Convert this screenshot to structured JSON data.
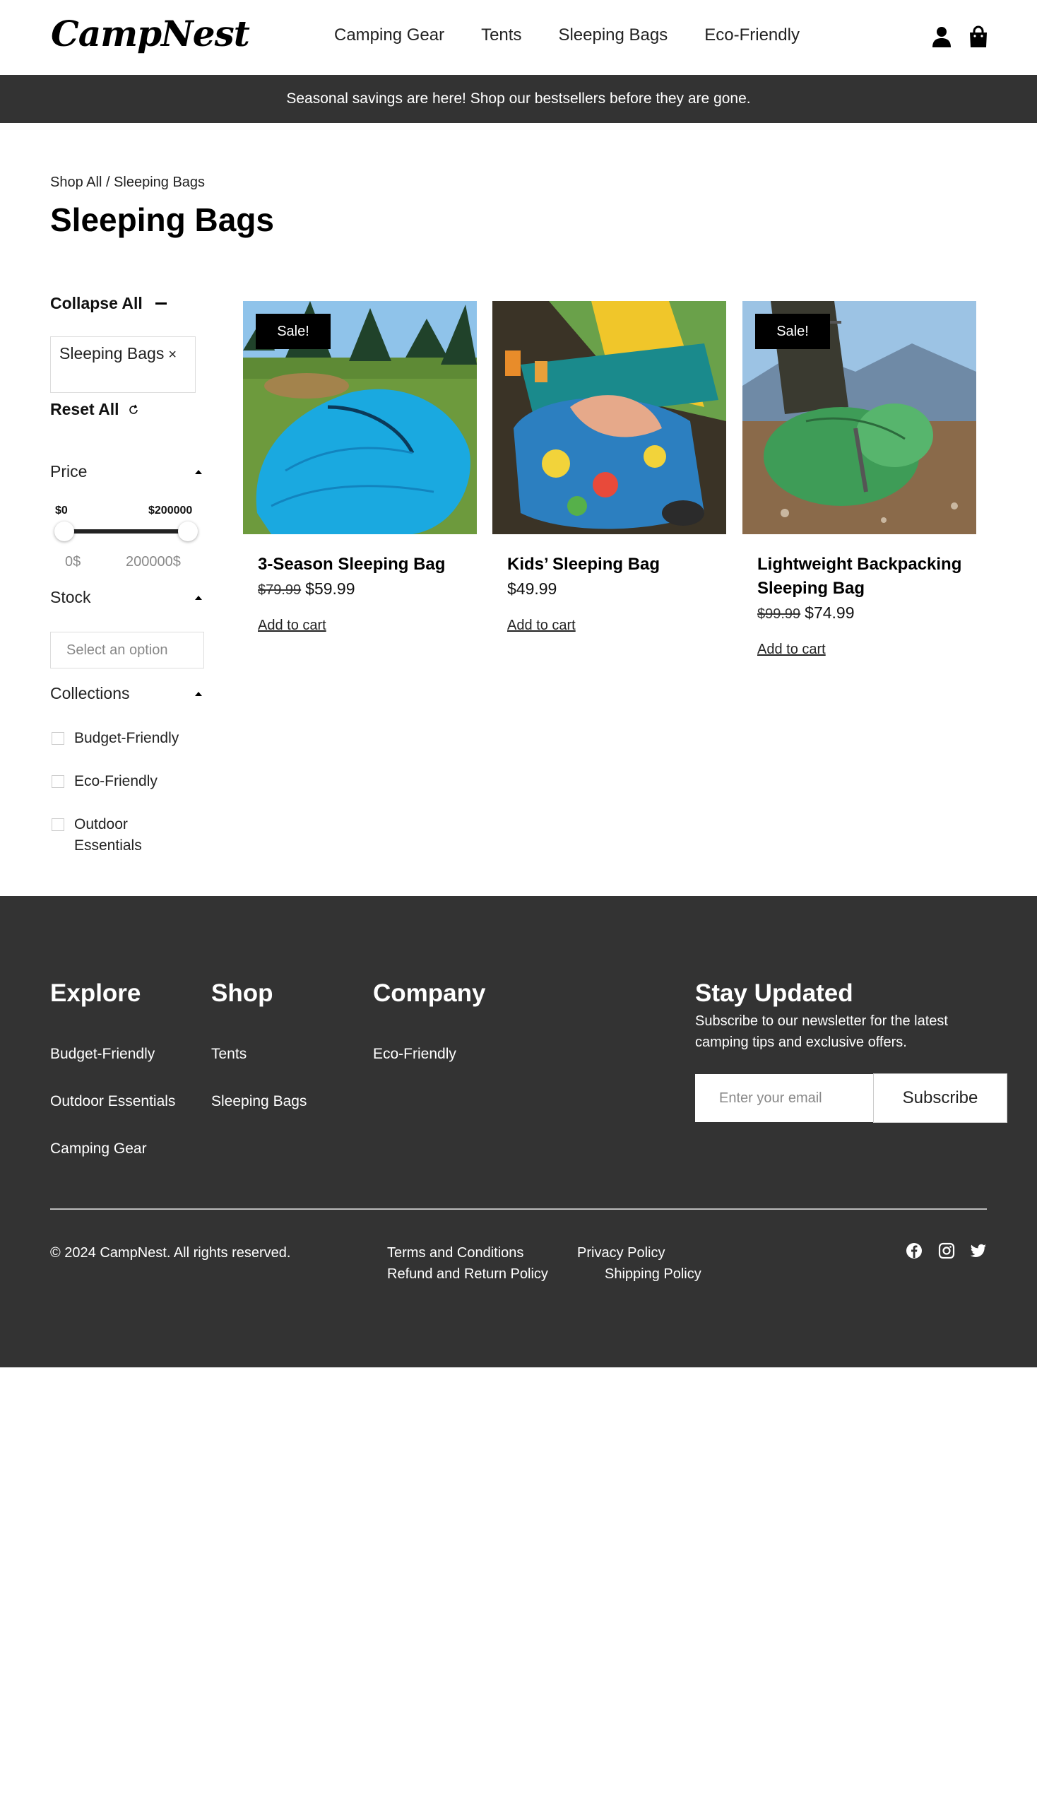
{
  "header": {
    "logo": "CampNest",
    "nav": [
      "Camping Gear",
      "Tents",
      "Sleeping Bags",
      "Eco-Friendly"
    ],
    "icons": [
      "user-icon",
      "shopping-bag-icon"
    ]
  },
  "announcement": "Seasonal savings are here! Shop our bestsellers before they are gone.",
  "breadcrumb": "Shop All / Sleeping Bags",
  "page_title": "Sleeping Bags",
  "sidebar": {
    "collapse_all": "Collapse All",
    "active_filter": "Sleeping Bags",
    "active_filter_remove": "×",
    "reset_all": "Reset All",
    "price": {
      "label": "Price",
      "min_label": "$0",
      "max_label": "$200000",
      "min_output": "0$",
      "max_output": "200000$"
    },
    "stock": {
      "label": "Stock",
      "placeholder": "Select an option"
    },
    "collections": {
      "label": "Collections",
      "items": [
        "Budget-Friendly",
        "Eco-Friendly",
        "Outdoor Essentials"
      ]
    }
  },
  "products": [
    {
      "name": "3-Season Sleeping Bag",
      "badge": "Sale!",
      "old_price": "$79.99",
      "price": "$59.99",
      "cta": "Add to cart"
    },
    {
      "name": "Kids’ Sleeping Bag",
      "badge": "",
      "old_price": "",
      "price": "$49.99",
      "cta": "Add to cart"
    },
    {
      "name": "Lightweight Backpacking Sleeping Bag",
      "badge": "Sale!",
      "old_price": "$99.99",
      "price": "$74.99",
      "cta": "Add to cart"
    }
  ],
  "footer": {
    "explore": {
      "heading": "Explore",
      "links": [
        "Budget-Friendly",
        "Outdoor Essentials",
        "Camping Gear"
      ]
    },
    "shop": {
      "heading": "Shop",
      "links": [
        "Tents",
        "Sleeping Bags"
      ]
    },
    "company": {
      "heading": "Company",
      "links": [
        "Eco-Friendly"
      ]
    },
    "newsletter": {
      "heading": "Stay Updated",
      "description": "Subscribe to our newsletter for the latest camping tips and exclusive offers.",
      "placeholder": "Enter your email",
      "button": "Subscribe"
    },
    "copyright": "© 2024 CampNest. All rights reserved.",
    "policies": [
      "Terms and Conditions",
      "Privacy Policy",
      "Refund and Return Policy",
      "Shipping Policy"
    ],
    "social": [
      "facebook-icon",
      "instagram-icon",
      "twitter-icon"
    ]
  }
}
